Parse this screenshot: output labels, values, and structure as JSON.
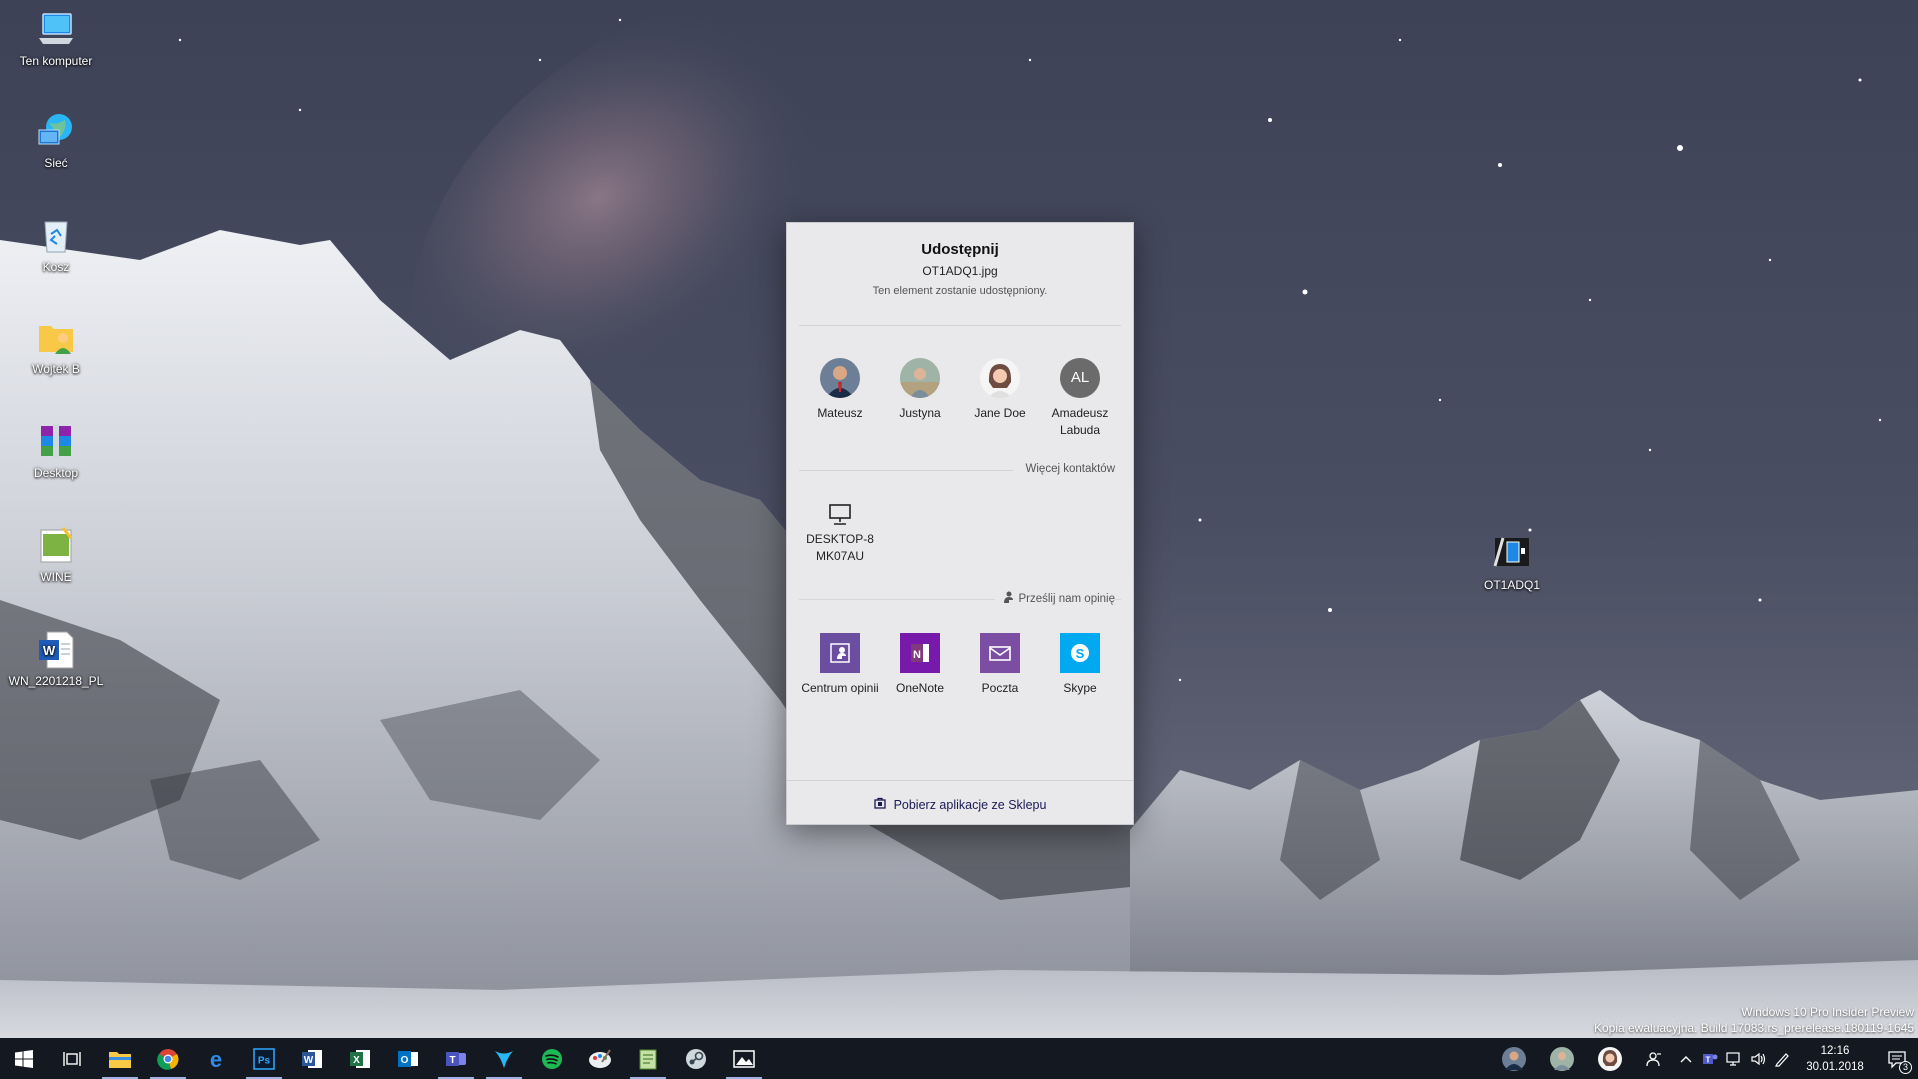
{
  "desktop": {
    "icons": [
      {
        "label": "Ten komputer",
        "icon": "computer-icon"
      },
      {
        "label": "Sieć",
        "icon": "network-icon"
      },
      {
        "label": "Kosz",
        "icon": "recycle-bin-icon"
      },
      {
        "label": "Wojtek B",
        "icon": "user-folder-icon"
      },
      {
        "label": "Desktop",
        "icon": "archive-icon"
      },
      {
        "label": "WINE",
        "icon": "wine-image-icon"
      },
      {
        "label": "WN_2201218_PL",
        "icon": "word-document-icon"
      },
      {
        "label": "OT1ADQ1",
        "icon": "image-file-icon"
      }
    ]
  },
  "share": {
    "title": "Udostępnij",
    "filename": "OT1ADQ1.jpg",
    "subtitle": "Ten element zostanie udostępniony.",
    "contacts": [
      {
        "name": "Mateusz"
      },
      {
        "name": "Justyna"
      },
      {
        "name": "Jane Doe"
      },
      {
        "name": "Amadeusz Labuda",
        "initials": "AL"
      }
    ],
    "more_contacts": "Więcej kontaktów",
    "device": {
      "name": "DESKTOP-8 MK07AU",
      "icon": "monitor-icon"
    },
    "feedback": "Prześlij nam opinię",
    "apps": [
      {
        "name": "Centrum opinii",
        "icon": "feedback-hub-icon",
        "color": "#6b4ea0"
      },
      {
        "name": "OneNote",
        "icon": "onenote-icon",
        "color": "#7719aa"
      },
      {
        "name": "Poczta",
        "icon": "mail-icon",
        "color": "#7c4ea3"
      },
      {
        "name": "Skype",
        "icon": "skype-icon",
        "color": "#00a9f0"
      }
    ],
    "store_link": "Pobierz aplikacje ze Sklepu"
  },
  "watermark": {
    "line1": "Windows 10 Pro Insider Preview",
    "line2": "Kopia ewaluacyjna. Build 17083.rs_prerelease.180119-1645"
  },
  "taskbar": {
    "apps": [
      "start-icon",
      "task-view-icon",
      "file-explorer-icon",
      "chrome-icon",
      "edge-icon",
      "photoshop-icon",
      "word-icon",
      "excel-icon",
      "outlook-icon",
      "teams-icon",
      "kite-icon",
      "spotify-icon",
      "paint-icon",
      "notepad-icon",
      "steam-icon",
      "photos-icon"
    ],
    "clock_time": "12:16",
    "clock_date": "30.01.2018",
    "notification_count": "3"
  },
  "colors": {
    "dialog_bg": "#e9e9ec",
    "taskbar_bg": "#141820",
    "accent": "#9fb4e6"
  }
}
